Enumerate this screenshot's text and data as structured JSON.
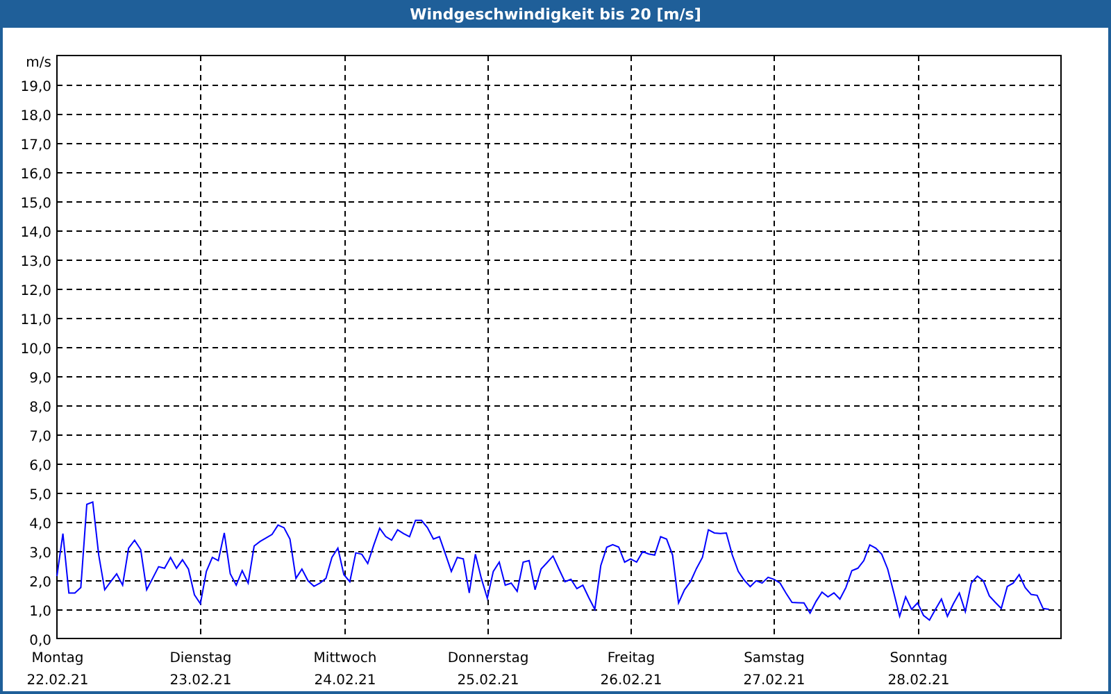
{
  "chart": {
    "dates": [
      "22.02.21",
      "23.02.21",
      "24.02.21",
      "25.02.21",
      "26.02.21",
      "27.02.21",
      "28.02.21"
    ],
    "chart_data": {
      "type": "line",
      "title": "Windgeschwindigkeit bis 20 [m/s]",
      "ylabel": "m/s",
      "ylim": [
        0,
        20
      ],
      "grid": true,
      "yticks": [
        {
          "value": 0,
          "label": "0,0"
        },
        {
          "value": 1,
          "label": "1,0"
        },
        {
          "value": 2,
          "label": "2,0"
        },
        {
          "value": 3,
          "label": "3,0"
        },
        {
          "value": 4,
          "label": "4,0"
        },
        {
          "value": 5,
          "label": "5,0"
        },
        {
          "value": 6,
          "label": "6,0"
        },
        {
          "value": 7,
          "label": "7,0"
        },
        {
          "value": 8,
          "label": "8,0"
        },
        {
          "value": 9,
          "label": "9,0"
        },
        {
          "value": 10,
          "label": "10,0"
        },
        {
          "value": 11,
          "label": "11,0"
        },
        {
          "value": 12,
          "label": "12,0"
        },
        {
          "value": 13,
          "label": "13,0"
        },
        {
          "value": 14,
          "label": "14,0"
        },
        {
          "value": 15,
          "label": "15,0"
        },
        {
          "value": 16,
          "label": "16,0"
        },
        {
          "value": 17,
          "label": "17,0"
        },
        {
          "value": 18,
          "label": "18,0"
        },
        {
          "value": 19,
          "label": "19,0"
        }
      ],
      "categories": [
        "Montag",
        null,
        null,
        null,
        null,
        null,
        null,
        null,
        null,
        null,
        null,
        null,
        null,
        null,
        null,
        null,
        null,
        null,
        null,
        null,
        null,
        null,
        null,
        null,
        "Dienstag",
        null,
        null,
        null,
        null,
        null,
        null,
        null,
        null,
        null,
        null,
        null,
        null,
        null,
        null,
        null,
        null,
        null,
        null,
        null,
        null,
        null,
        null,
        null,
        "Mittwoch",
        null,
        null,
        null,
        null,
        null,
        null,
        null,
        null,
        null,
        null,
        null,
        null,
        null,
        null,
        null,
        null,
        null,
        null,
        null,
        null,
        null,
        null,
        null,
        "Donnerstag",
        null,
        null,
        null,
        null,
        null,
        null,
        null,
        null,
        null,
        null,
        null,
        null,
        null,
        null,
        null,
        null,
        null,
        null,
        null,
        null,
        null,
        null,
        null,
        "Freitag",
        null,
        null,
        null,
        null,
        null,
        null,
        null,
        null,
        null,
        null,
        null,
        null,
        null,
        null,
        null,
        null,
        null,
        null,
        null,
        null,
        null,
        null,
        null,
        "Samstag",
        null,
        null,
        null,
        null,
        null,
        null,
        null,
        null,
        null,
        null,
        null,
        null,
        null,
        null,
        null,
        null,
        null,
        null,
        null,
        null,
        null,
        null,
        null,
        "Sonntag",
        null,
        null,
        null,
        null,
        null,
        null,
        null,
        null,
        null,
        null,
        null,
        null,
        null,
        null,
        null,
        null,
        null,
        null,
        null,
        null,
        null,
        null,
        null
      ],
      "series": [
        {
          "color": "#0000ff",
          "values": [
            2.14,
            3.6,
            1.56,
            1.56,
            1.75,
            4.6,
            4.68,
            2.86,
            1.67,
            1.95,
            2.22,
            1.83,
            3.1,
            3.37,
            3.05,
            1.67,
            2.06,
            2.46,
            2.41,
            2.78,
            2.41,
            2.7,
            2.38,
            1.5,
            1.19,
            2.3,
            2.78,
            2.67,
            3.62,
            2.22,
            1.83,
            2.33,
            1.9,
            3.17,
            3.33,
            3.45,
            3.57,
            3.89,
            3.8,
            3.41,
            2.06,
            2.38,
            1.98,
            1.79,
            1.9,
            2.06,
            2.78,
            3.1,
            2.19,
            1.95,
            2.94,
            2.89,
            2.57,
            3.2,
            3.78,
            3.5,
            3.37,
            3.73,
            3.6,
            3.49,
            4.05,
            4.05,
            3.8,
            3.41,
            3.49,
            2.9,
            2.3,
            2.78,
            2.73,
            1.56,
            2.89,
            2.06,
            1.38,
            2.3,
            2.62,
            1.83,
            1.9,
            1.62,
            2.62,
            2.67,
            1.67,
            2.38,
            2.6,
            2.83,
            2.38,
            1.95,
            2.03,
            1.71,
            1.83,
            1.4,
            1.0,
            2.5,
            3.13,
            3.22,
            3.14,
            2.62,
            2.73,
            2.62,
            2.98,
            2.9,
            2.86,
            3.49,
            3.41,
            2.86,
            1.22,
            1.67,
            1.95,
            2.4,
            2.78,
            3.73,
            3.62,
            3.6,
            3.62,
            2.86,
            2.3,
            2.0,
            1.78,
            1.98,
            1.9,
            2.1,
            2.03,
            1.9,
            1.55,
            1.24,
            1.23,
            1.22,
            0.87,
            1.27,
            1.59,
            1.43,
            1.56,
            1.35,
            1.75,
            2.33,
            2.41,
            2.67,
            3.21,
            3.1,
            2.89,
            2.38,
            1.59,
            0.76,
            1.43,
            1.0,
            1.22,
            0.79,
            0.63,
            1.0,
            1.35,
            0.76,
            1.19,
            1.56,
            0.92,
            1.9,
            2.14,
            1.98,
            1.46,
            1.24,
            1.03,
            1.78,
            1.9,
            2.19,
            1.75,
            1.51,
            1.48,
            1.03,
            1.0,
            null
          ]
        }
      ]
    }
  }
}
